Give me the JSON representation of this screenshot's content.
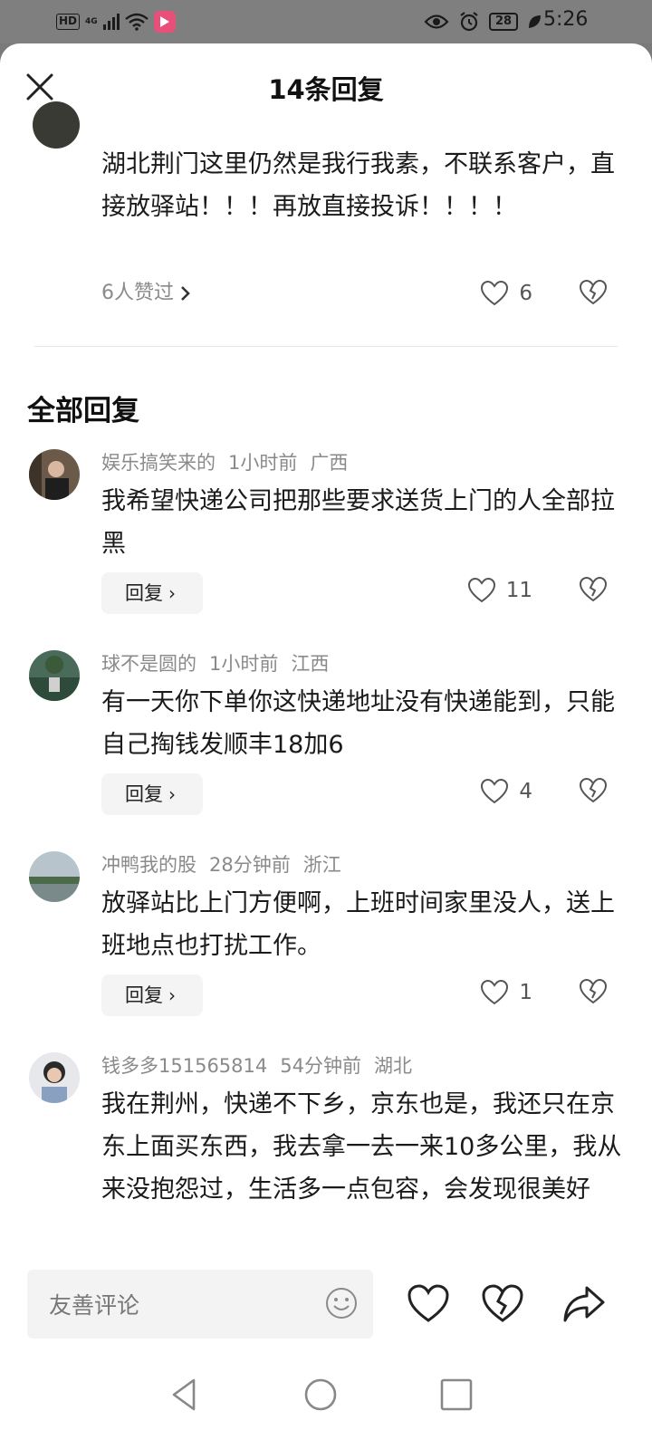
{
  "status": {
    "net_label": "HD",
    "net_type": "4G",
    "battery": "28",
    "time": "5:26"
  },
  "header": {
    "title": "14条回复"
  },
  "parent_comment": {
    "text": "湖北荆门这里仍然是我行我素，不联系客户，直接放驿站！！！再放直接投诉！！！！",
    "likes_link": "6人赞过",
    "like_count": "6"
  },
  "section_title": "全部回复",
  "comments": [
    {
      "user": "娱乐搞笑来的",
      "time": "1小时前",
      "region": "广西",
      "text": "我希望快递公司把那些要求送货上门的人全部拉黑",
      "reply_label": "回复",
      "like_count": "11"
    },
    {
      "user": "球不是圆的",
      "time": "1小时前",
      "region": "江西",
      "text": "有一天你下单你这快递地址没有快递能到，只能自己掏钱发顺丰18加6",
      "reply_label": "回复",
      "like_count": "4"
    },
    {
      "user": "冲鸭我的股",
      "time": "28分钟前",
      "region": "浙江",
      "text": "放驿站比上门方便啊，上班时间家里没人，送上班地点也打扰工作。",
      "reply_label": "回复",
      "like_count": "1"
    },
    {
      "user": "钱多多151565814",
      "time": "54分钟前",
      "region": "湖北",
      "text": "我在荆州，快递不下乡，京东也是，我还只在京东上面买东西，我去拿一去一来10多公里，我从来没抱怨过，生活多一点包容，会发现很美好"
    }
  ],
  "input": {
    "placeholder": "友善评论"
  },
  "colors": {
    "status_bar": "#7f7f7f",
    "reply_bg": "#f4f4f4",
    "muted": "#8a8a8a"
  }
}
